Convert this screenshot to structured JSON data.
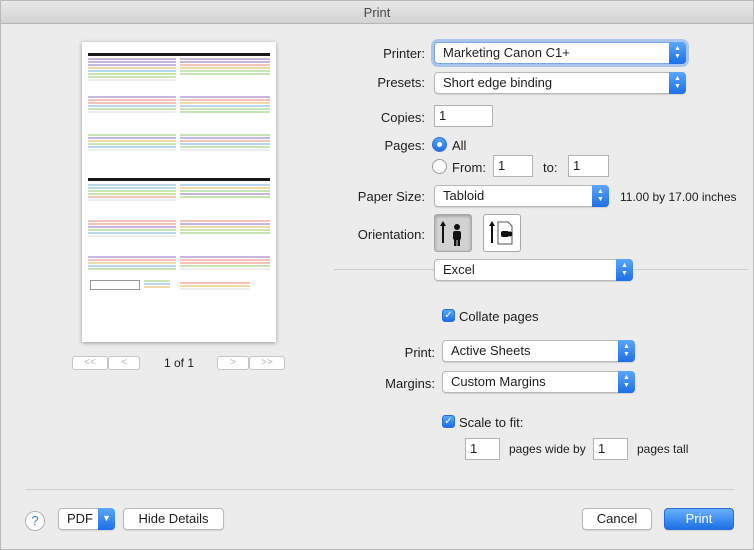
{
  "window": {
    "title": "Print"
  },
  "preview": {
    "page_indicator": "1 of 1",
    "first_glyph": "<<",
    "prev_glyph": "<",
    "next_glyph": ">",
    "last_glyph": ">>"
  },
  "printer": {
    "label": "Printer:",
    "value": "Marketing Canon C1+"
  },
  "presets": {
    "label": "Presets:",
    "value": "Short edge binding"
  },
  "copies": {
    "label": "Copies:",
    "value": "1"
  },
  "pages": {
    "label": "Pages:",
    "all_label": "All",
    "from_label": "From:",
    "from_value": "1",
    "to_label": "to:",
    "to_value": "1"
  },
  "paper_size": {
    "label": "Paper Size:",
    "value": "Tabloid",
    "dimensions": "11.00 by 17.00 inches"
  },
  "orientation": {
    "label": "Orientation:"
  },
  "app_section": {
    "value": "Excel"
  },
  "collate": {
    "label": "Collate pages",
    "checked": true
  },
  "print_what": {
    "label": "Print:",
    "value": "Active Sheets"
  },
  "margins": {
    "label": "Margins:",
    "value": "Custom Margins"
  },
  "scale": {
    "label": "Scale to fit:",
    "wide_value": "1",
    "wide_label": "pages wide by",
    "tall_value": "1",
    "tall_label": "pages tall"
  },
  "footer": {
    "help": "?",
    "pdf": "PDF",
    "hide_details": "Hide Details",
    "cancel": "Cancel",
    "print": "Print"
  },
  "colors": {
    "accent": "#1d6fe6",
    "background": "#ececec"
  }
}
